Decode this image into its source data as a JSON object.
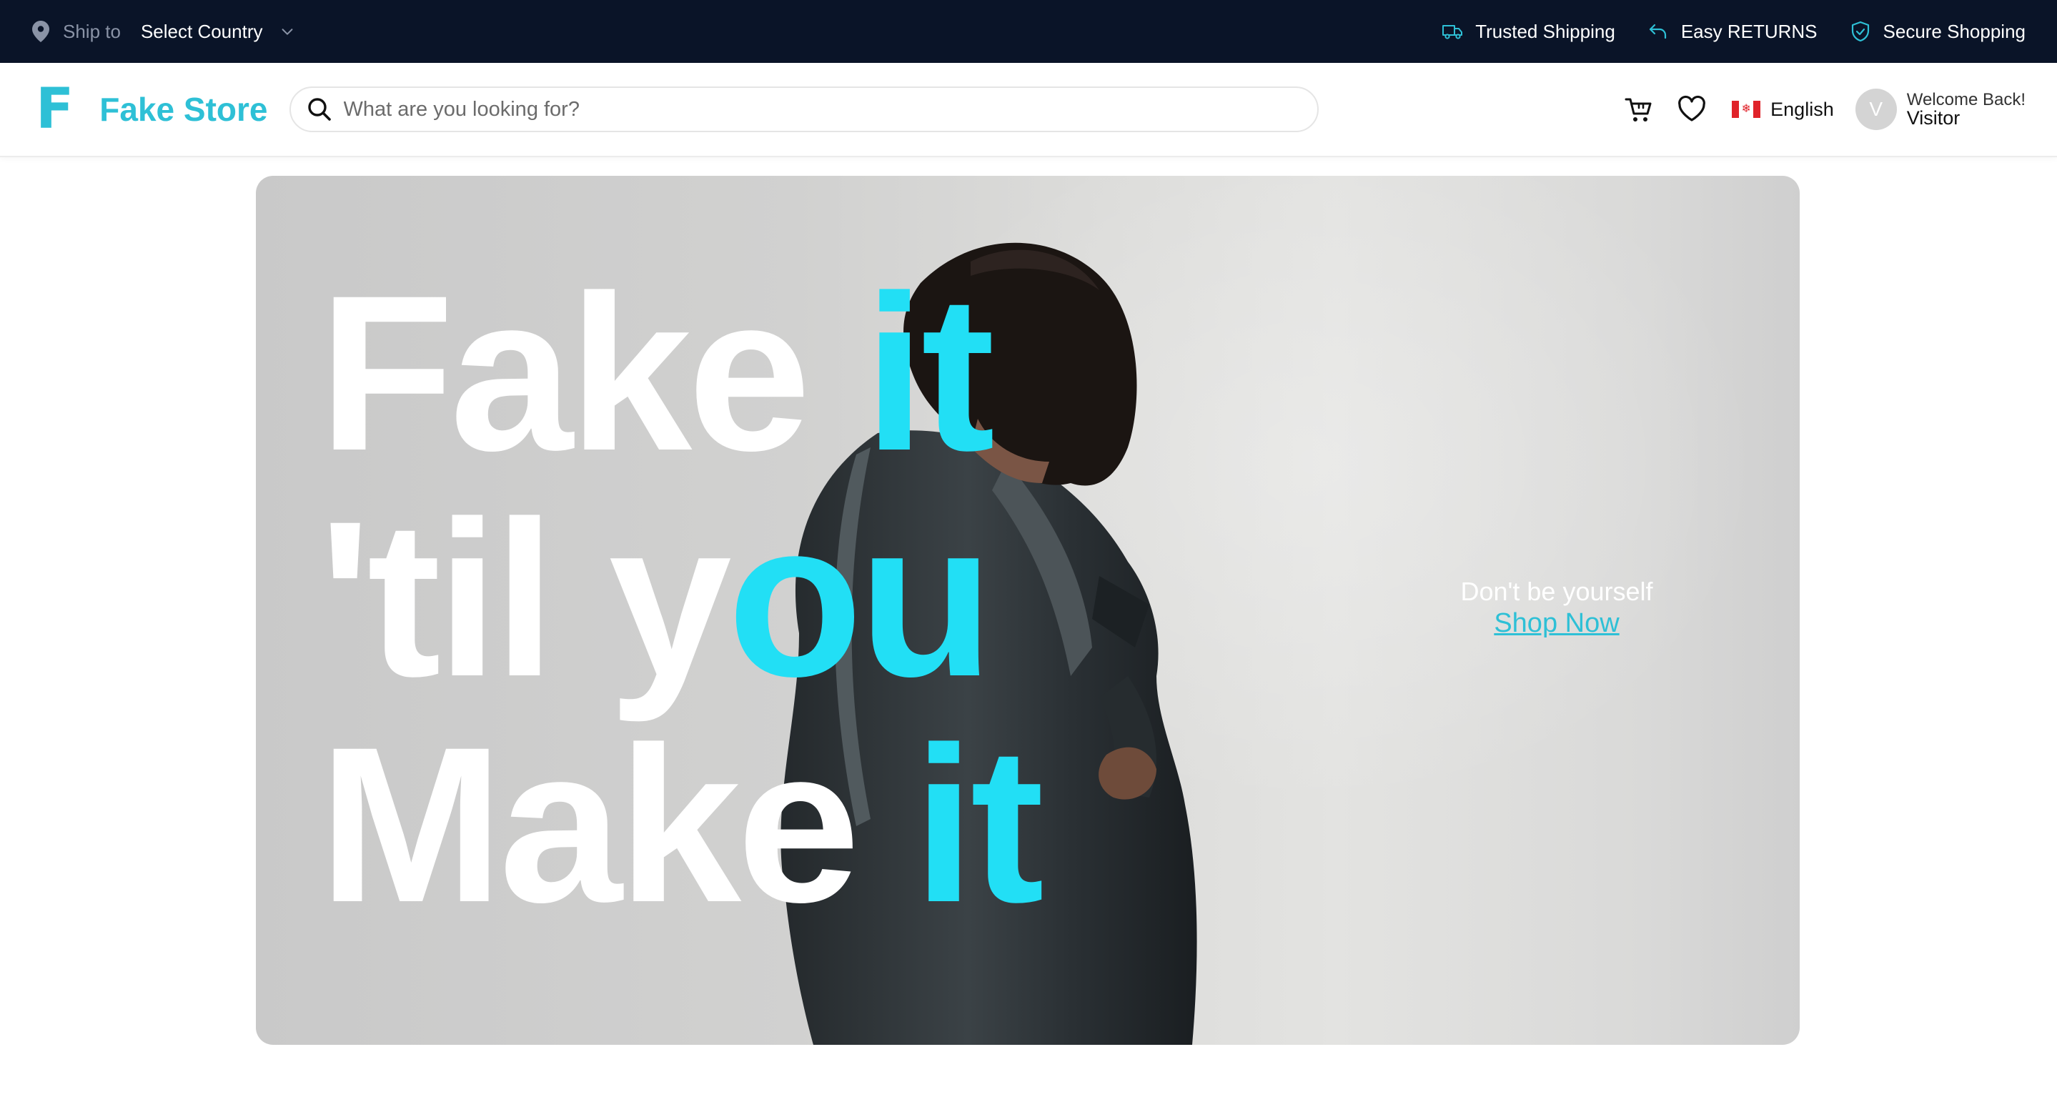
{
  "topbar": {
    "ship_label": "Ship to",
    "country_select": "Select Country",
    "perks": [
      {
        "label": "Trusted Shipping",
        "icon": "truck-icon"
      },
      {
        "label": "Easy RETURNS",
        "icon": "return-arrow-icon"
      },
      {
        "label": "Secure Shopping",
        "icon": "shield-check-icon"
      }
    ]
  },
  "header": {
    "logo_mark": "F",
    "brand": "Fake Store",
    "search_placeholder": "What are you looking for?",
    "language": "English",
    "avatar_initial": "V",
    "welcome": "Welcome Back!",
    "user": "Visitor"
  },
  "hero": {
    "headline_lines": [
      {
        "white": "Fake ",
        "accent": "it"
      },
      {
        "white": "'til y",
        "accent": "ou"
      },
      {
        "white": "Make ",
        "accent": "it"
      }
    ],
    "tagline": "Don't be yourself",
    "cta": "Shop Now"
  },
  "colors": {
    "topbar_bg": "#0a1428",
    "brand": "#2ec0d6",
    "accent": "#22dff5"
  }
}
